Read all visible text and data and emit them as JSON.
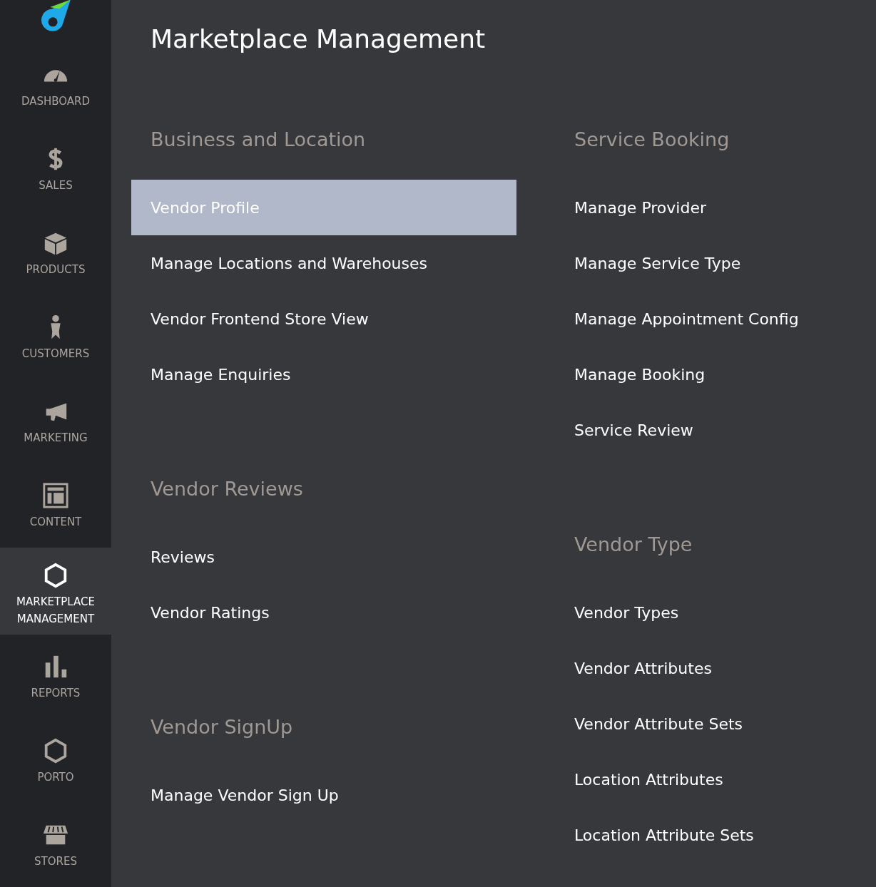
{
  "sidebar": {
    "items": [
      {
        "label": "DASHBOARD",
        "selected": false
      },
      {
        "label": "SALES",
        "selected": false
      },
      {
        "label": "PRODUCTS",
        "selected": false
      },
      {
        "label": "CUSTOMERS",
        "selected": false
      },
      {
        "label": "MARKETING",
        "selected": false
      },
      {
        "label": "CONTENT",
        "selected": false
      },
      {
        "label": "MARKETPLACE MANAGEMENT",
        "selected": true
      },
      {
        "label": "REPORTS",
        "selected": false
      },
      {
        "label": "PORTO",
        "selected": false
      },
      {
        "label": "STORES",
        "selected": false
      }
    ]
  },
  "page_title": "Marketplace Management",
  "columns": [
    [
      {
        "heading": "Business and Location",
        "items": [
          {
            "label": "Vendor Profile",
            "selected": true
          },
          {
            "label": "Manage Locations and Warehouses",
            "selected": false
          },
          {
            "label": "Vendor Frontend Store View",
            "selected": false
          },
          {
            "label": "Manage Enquiries",
            "selected": false
          }
        ]
      },
      {
        "heading": "Vendor Reviews",
        "items": [
          {
            "label": "Reviews",
            "selected": false
          },
          {
            "label": "Vendor Ratings",
            "selected": false
          }
        ]
      },
      {
        "heading": "Vendor SignUp",
        "items": [
          {
            "label": "Manage Vendor Sign Up",
            "selected": false
          }
        ]
      }
    ],
    [
      {
        "heading": "Service Booking",
        "items": [
          {
            "label": "Manage Provider",
            "selected": false
          },
          {
            "label": "Manage Service Type",
            "selected": false
          },
          {
            "label": "Manage Appointment Config",
            "selected": false
          },
          {
            "label": "Manage Booking",
            "selected": false
          },
          {
            "label": "Service Review",
            "selected": false
          }
        ]
      },
      {
        "heading": "Vendor Type",
        "items": [
          {
            "label": "Vendor Types",
            "selected": false
          },
          {
            "label": "Vendor Attributes",
            "selected": false
          },
          {
            "label": "Vendor Attribute Sets",
            "selected": false
          },
          {
            "label": "Location Attributes",
            "selected": false
          },
          {
            "label": "Location Attribute Sets",
            "selected": false
          }
        ]
      }
    ]
  ]
}
